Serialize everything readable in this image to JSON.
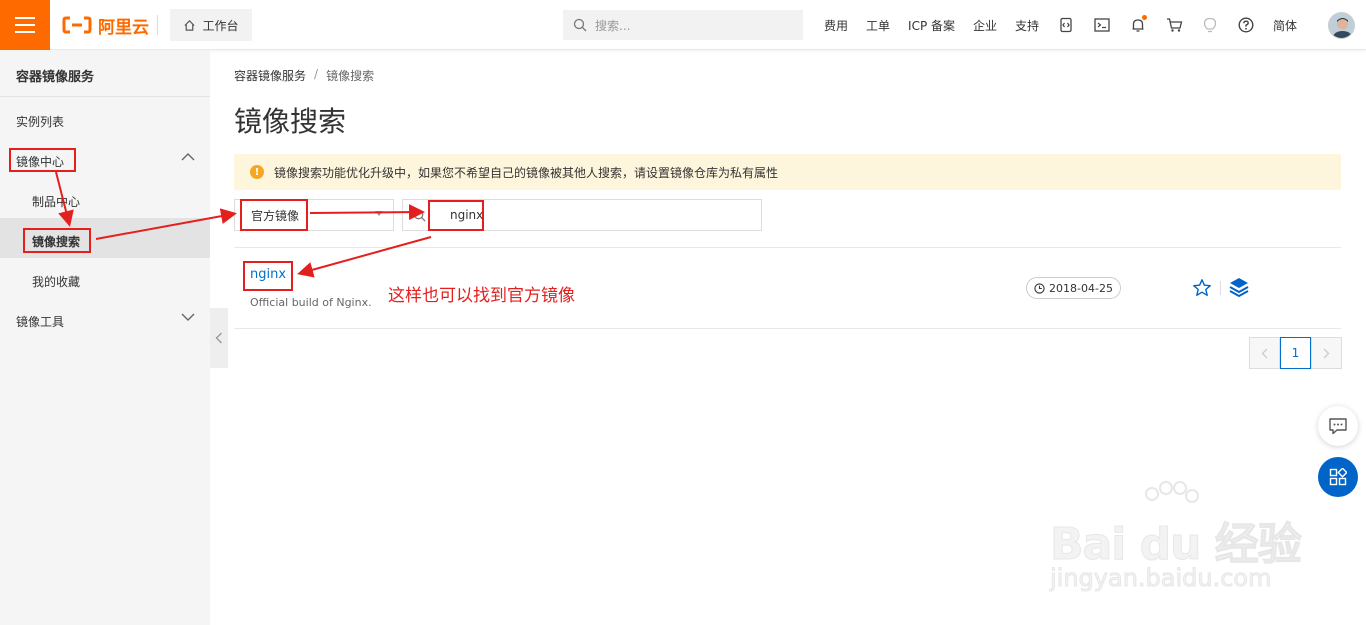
{
  "topbar": {
    "brand": "阿里云",
    "workbench_label": "工作台",
    "search_placeholder": "搜索...",
    "nav_items": [
      "费用",
      "工单",
      "ICP 备案",
      "企业",
      "支持"
    ],
    "lang_label": "简体"
  },
  "sidebar": {
    "title": "容器镜像服务",
    "items": {
      "instances": "实例列表",
      "mirror_center": "镜像中心",
      "artifact_center": "制品中心",
      "mirror_search": "镜像搜索",
      "my_favorites": "我的收藏",
      "mirror_tools": "镜像工具"
    }
  },
  "breadcrumb": {
    "root": "容器镜像服务",
    "separator": "/",
    "current": "镜像搜索"
  },
  "page": {
    "title": "镜像搜索",
    "notice": "镜像搜索功能优化升级中，如果您不希望自己的镜像被其他人搜索，请设置镜像仓库为私有属性"
  },
  "filters": {
    "source_select_value": "官方镜像",
    "search_value": "nginx"
  },
  "results": [
    {
      "name": "nginx",
      "description": "Official build of Nginx.",
      "date": "2018-04-25"
    }
  ],
  "pagination": {
    "current_page": "1"
  },
  "annotation_text": "这样也可以找到官方镜像",
  "watermark": {
    "main": "Bai du 经验",
    "sub": "jingyan.baidu.com"
  },
  "colors": {
    "brand_orange": "#ff6a00",
    "link_blue": "#0070cc",
    "annotation_red": "#e4201f",
    "notice_bg": "#fdf5dc"
  }
}
